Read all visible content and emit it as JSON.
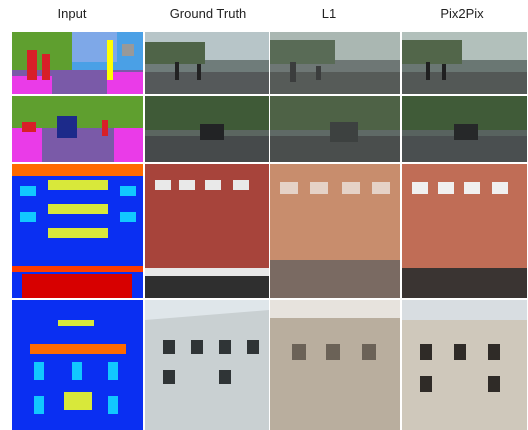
{
  "headers": {
    "input": "Input",
    "ground_truth": "Ground Truth",
    "l1": "L1",
    "pix2pix": "Pix2Pix"
  },
  "figure": {
    "columns": 4,
    "rows": 4,
    "row_contents": [
      [
        "street segmentation map",
        "street photo",
        "blurry street photo",
        "street photo"
      ],
      [
        "street segmentation map with car",
        "street photo with car",
        "blurry street photo with car",
        "street photo with car"
      ],
      [
        "facade label map",
        "red brick facade photo",
        "blurry facade photo",
        "facade photo"
      ],
      [
        "facade label map",
        "white building photo",
        "blurry building photo",
        "building photo"
      ]
    ]
  }
}
